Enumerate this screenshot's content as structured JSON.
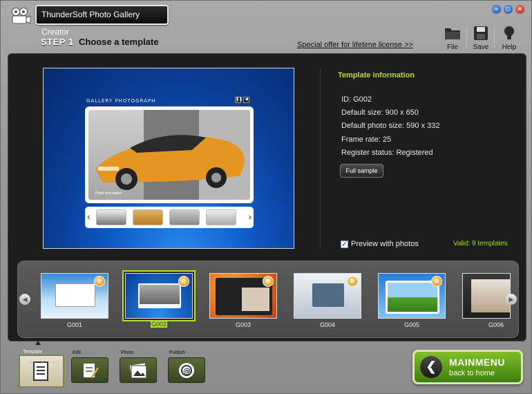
{
  "app": {
    "title": "ThunderSoft Photo Gallery Creator"
  },
  "window_buttons": {
    "minimize": "−",
    "restore": "□",
    "close": "×"
  },
  "step": {
    "label": "STEP 1",
    "title": "Choose a template"
  },
  "offer_link": "Special offer for lifetime license >>",
  "toolbar": {
    "file": "File",
    "save": "Save",
    "help": "Help"
  },
  "preview": {
    "gallery_title": "GALLERY PHOTOGRAPH",
    "photo_caption": "Photo description"
  },
  "info": {
    "title": "Template information",
    "id": "ID: G002",
    "default_size": "Default size: 900 x 650",
    "default_photo_size": "Default photo size: 590 x 332",
    "frame_rate": "Frame rate: 25",
    "register_status": "Register status: Registered",
    "full_sample_label": "Full sample"
  },
  "preview_with_photos": {
    "label": "Preview with photos",
    "checked": true
  },
  "valid_text": "Valid: 9 templates",
  "templates": [
    {
      "name": "G001",
      "selected": false
    },
    {
      "name": "G002",
      "selected": true
    },
    {
      "name": "G003",
      "selected": false
    },
    {
      "name": "G004",
      "selected": false
    },
    {
      "name": "G005",
      "selected": false
    },
    {
      "name": "G006",
      "selected": false
    }
  ],
  "nav_tabs": [
    {
      "label": "Template",
      "active": true
    },
    {
      "label": "Edit",
      "active": false
    },
    {
      "label": "Photo",
      "active": false
    },
    {
      "label": "Publish",
      "active": false
    }
  ],
  "main_menu": {
    "title": "MAINMENU",
    "subtitle": "back to home"
  },
  "colors": {
    "accent_green": "#b7e02a",
    "info_title": "#b8d82a",
    "panel_bg": "#1d1d1d"
  }
}
